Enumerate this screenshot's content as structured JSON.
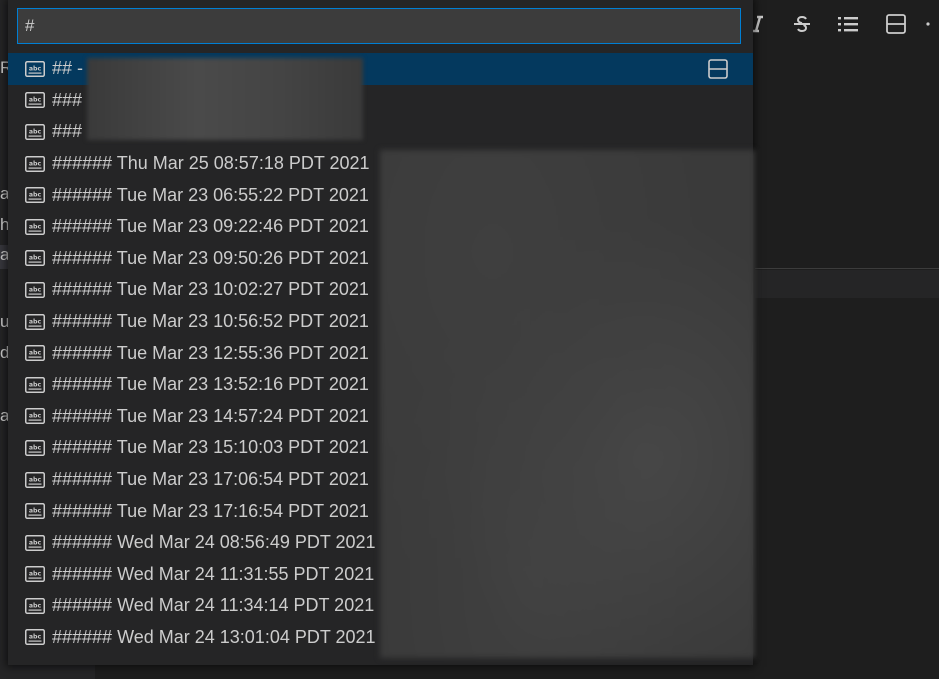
{
  "quick_pick": {
    "input_value": "#",
    "items": [
      {
        "label": "## -"
      },
      {
        "label": "###"
      },
      {
        "label": "###"
      },
      {
        "label": "###### Thu Mar 25 08:57:18 PDT 2021"
      },
      {
        "label": "###### Tue Mar 23 06:55:22 PDT 2021"
      },
      {
        "label": "###### Tue Mar 23 09:22:46 PDT 2021"
      },
      {
        "label": "###### Tue Mar 23 09:50:26 PDT 2021"
      },
      {
        "label": "###### Tue Mar 23 10:02:27 PDT 2021"
      },
      {
        "label": "###### Tue Mar 23 10:56:52 PDT 2021"
      },
      {
        "label": "###### Tue Mar 23 12:55:36 PDT 2021"
      },
      {
        "label": "###### Tue Mar 23 13:52:16 PDT 2021"
      },
      {
        "label": "###### Tue Mar 23 14:57:24 PDT 2021"
      },
      {
        "label": "###### Tue Mar 23 15:10:03 PDT 2021"
      },
      {
        "label": "###### Tue Mar 23 17:06:54 PDT 2021"
      },
      {
        "label": "###### Tue Mar 23 17:16:54 PDT 2021"
      },
      {
        "label": "###### Wed Mar 24 08:56:49 PDT 2021"
      },
      {
        "label": "###### Wed Mar 24 11:31:55 PDT 2021"
      },
      {
        "label": "###### Wed Mar 24 11:34:14 PDT 2021"
      },
      {
        "label": "###### Wed Mar 24 13:01:04 PDT 2021"
      }
    ],
    "item_icon": "symbol-string-icon",
    "active_item_action_icon": "split-editor-icon"
  },
  "editor_toolbar": {
    "icons": [
      "italic-icon",
      "strikethrough-icon",
      "list-icon",
      "split-editor-icon",
      "more-icon"
    ]
  },
  "background_fragments": [
    "Rl",
    "a",
    "h",
    "a",
    "ul",
    "d",
    "a"
  ],
  "colors": {
    "accent": "#007fd4",
    "active_row": "#04395e",
    "palette_bg": "#252526",
    "editor_bg": "#1e1e1e"
  }
}
